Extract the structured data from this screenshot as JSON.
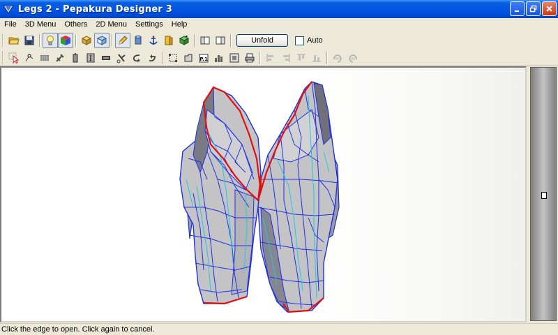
{
  "window": {
    "title": "Legs 2 - Pepakura Designer 3"
  },
  "menubar": {
    "items": [
      "File",
      "3D Menu",
      "Others",
      "2D Menu",
      "Settings",
      "Help"
    ]
  },
  "toolbar1": {
    "icons": [
      "open-folder-icon",
      "save-icon",
      "lightbulb-icon",
      "color-cube-icon",
      "box-icon",
      "box-texture-icon",
      "pencil-icon",
      "cylinder-icon",
      "anchor-icon",
      "book-icon",
      "cube-green-icon",
      "single-view-icon",
      "split-view-icon"
    ],
    "unfold_label": "Unfold",
    "auto_label": "Auto",
    "auto_checked": false
  },
  "toolbar2": {
    "icons": [
      "select-arrow-icon",
      "move-point-icon",
      "grid-icon",
      "tool-icon",
      "column-icon",
      "text-box-icon",
      "flap-icon",
      "cut-icon",
      "join-icon",
      "rotate-icon",
      "select-box-icon",
      "piece-icon",
      "page-num-icon",
      "chart-icon",
      "frame-icon",
      "print-icon",
      "align-left-icon",
      "align-right-icon",
      "align-top-icon",
      "align-bottom-icon",
      "rotate-90-icon",
      "rotate-90-ccw-icon"
    ]
  },
  "status": {
    "text": "Click the edge to open. Click again to cancel."
  },
  "colors": {
    "mesh_edge": "#2030e0",
    "seam_edge": "#e01010",
    "fold_line": "#20c8e0",
    "face_light": "#c4c4c6",
    "face_dark": "#808088"
  }
}
